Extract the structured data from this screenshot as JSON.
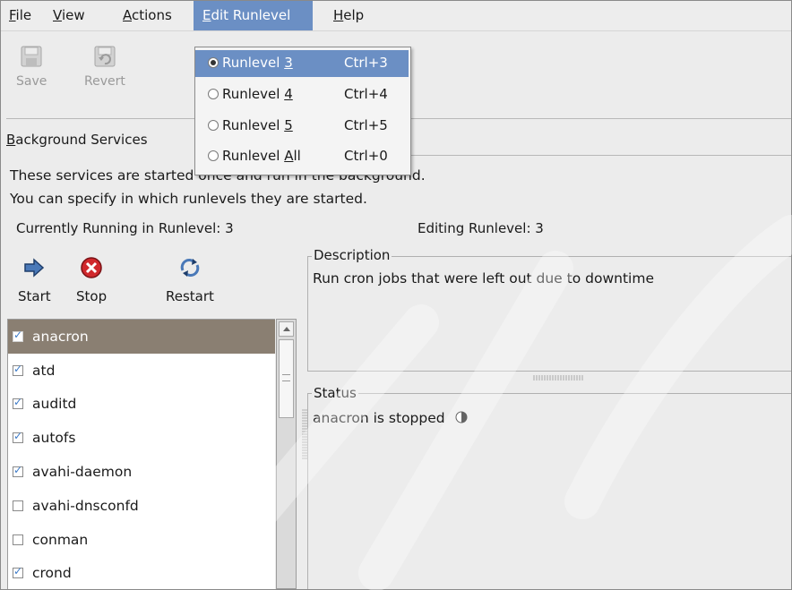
{
  "menubar": {
    "items": [
      {
        "pre": "",
        "key": "F",
        "post": "ile"
      },
      {
        "pre": "",
        "key": "V",
        "post": "iew"
      },
      {
        "pre": "",
        "key": "A",
        "post": "ctions"
      },
      {
        "pre": "",
        "key": "E",
        "post": "dit Runlevel"
      },
      {
        "pre": "",
        "key": "H",
        "post": "elp"
      }
    ]
  },
  "toolbar": {
    "save_label": "Save",
    "revert_label": "Revert"
  },
  "tab": {
    "key": "B",
    "rest": "ackground Services"
  },
  "description_lines": [
    "These services are started once and run in the background.",
    "You can specify in which runlevels they are started."
  ],
  "running_label": "Currently Running in Runlevel: 3",
  "editing_label": "Editing Runlevel: 3",
  "actions": {
    "start": "Start",
    "stop": "Stop",
    "restart": "Restart"
  },
  "services": [
    {
      "name": "anacron",
      "checked": true,
      "selected": true
    },
    {
      "name": "atd",
      "checked": true,
      "selected": false
    },
    {
      "name": "auditd",
      "checked": true,
      "selected": false
    },
    {
      "name": "autofs",
      "checked": true,
      "selected": false
    },
    {
      "name": "avahi-daemon",
      "checked": true,
      "selected": false
    },
    {
      "name": "avahi-dnsconfd",
      "checked": false,
      "selected": false
    },
    {
      "name": "conman",
      "checked": false,
      "selected": false
    },
    {
      "name": "crond",
      "checked": true,
      "selected": false
    }
  ],
  "description_pane": {
    "title": "Description",
    "text": "Run cron jobs that were left out due to downtime"
  },
  "status_pane": {
    "title": "Status",
    "text": "anacron is stopped"
  },
  "runlevel_menu": {
    "items": [
      {
        "pre": "Runlevel ",
        "key": "3",
        "post": "",
        "accel": "Ctrl+3",
        "active": true
      },
      {
        "pre": "Runlevel ",
        "key": "4",
        "post": "",
        "accel": "Ctrl+4",
        "active": false
      },
      {
        "pre": "Runlevel ",
        "key": "5",
        "post": "",
        "accel": "Ctrl+5",
        "active": false
      },
      {
        "pre": "Runlevel ",
        "key": "A",
        "post": "ll",
        "accel": "Ctrl+0",
        "active": false
      }
    ]
  },
  "colors": {
    "menu_highlight": "#6b8fc4",
    "selected_row": "#8a7f72",
    "check_blue": "#3d7bc8",
    "stop_red": "#d0282c"
  }
}
